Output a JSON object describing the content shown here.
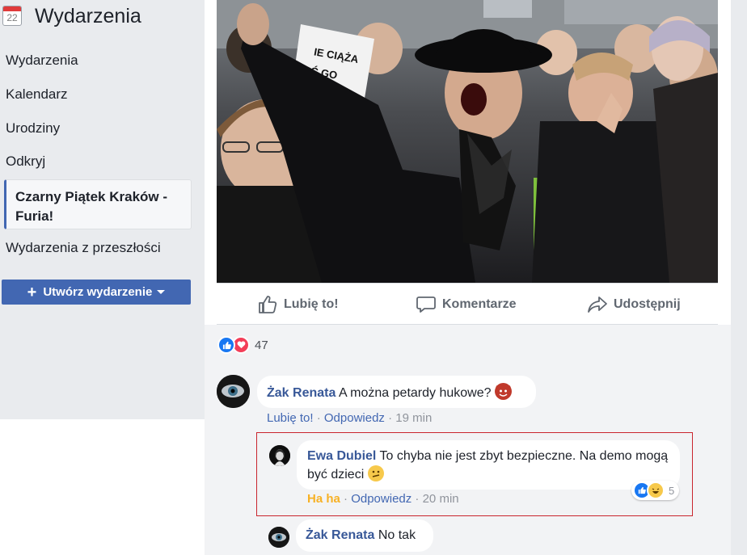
{
  "sidebar": {
    "calendar_icon_number": "22",
    "title": "Wydarzenia",
    "items": [
      {
        "label": "Wydarzenia"
      },
      {
        "label": "Kalendarz"
      },
      {
        "label": "Urodziny"
      },
      {
        "label": "Odkryj"
      }
    ],
    "active_item": {
      "label": "Czarny Piątek Kraków - Furia!"
    },
    "past_events": "Wydarzenia z przeszłości",
    "create_button": "Utwórz wydarzenie"
  },
  "post": {
    "photo_sign_text": "IE CIĄŻA Ć GO !",
    "actions": {
      "like": "Lubię to!",
      "comment": "Komentarze",
      "share": "Udostępnij"
    },
    "reactions": {
      "icons": [
        "like-icon",
        "love-icon"
      ],
      "count": "47"
    }
  },
  "comments": [
    {
      "author": "Żak Renata",
      "text": "A można petardy hukowe?",
      "emoji": "devil-emoji",
      "meta": {
        "like": "Lubię to!",
        "reply": "Odpowiedz",
        "time": "19 min"
      }
    },
    {
      "author": "Ewa Dubiel",
      "text": "To chyba nie jest zbyt bezpieczne. Na demo mogą być dzieci",
      "emoji": "confused-emoji",
      "meta": {
        "reaction": "Ha ha",
        "reply": "Odpowiedz",
        "time": "20 min"
      },
      "reaction_count": "5",
      "highlight_color": "#c9252d"
    },
    {
      "author": "Żak Renata",
      "text": "No tak"
    }
  ],
  "colors": {
    "brand": "#4267b2",
    "link": "#385898",
    "haha": "#f7b125"
  }
}
